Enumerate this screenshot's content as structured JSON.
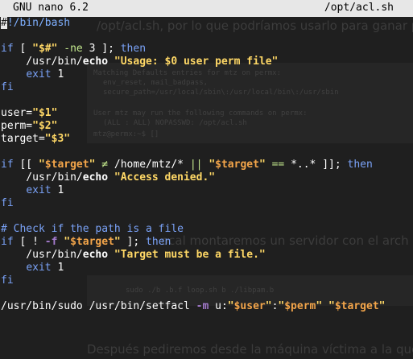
{
  "window": {
    "app_title": "GNU nano 6.2",
    "file_path": "/opt/acl.sh"
  },
  "colors": {
    "titlebar_bg": "#e7e7e7",
    "editor_bg": "#1f1f1f",
    "keyword": "#7aa2f7",
    "string": "#ffd866",
    "variable": "#f3a54a",
    "operator": "#c3e88d",
    "flag": "#a37acc"
  },
  "lines": [
    [
      [
        "cursor",
        "#"
      ],
      [
        "shebang",
        "!/bin/bash"
      ]
    ],
    [],
    [
      [
        "kw",
        "if"
      ],
      [
        "t",
        " [ "
      ],
      [
        "str",
        "\"$#\""
      ],
      [
        "t",
        " "
      ],
      [
        "op",
        "-ne"
      ],
      [
        "t",
        " 3 ]; "
      ],
      [
        "kw",
        "then"
      ]
    ],
    [
      [
        "t",
        "    /usr/bin/"
      ],
      [
        "bi",
        "echo"
      ],
      [
        "t",
        " "
      ],
      [
        "str",
        "\"Usage: $0 user perm file\""
      ]
    ],
    [
      [
        "t",
        "    "
      ],
      [
        "kw",
        "exit"
      ],
      [
        "t",
        " 1"
      ]
    ],
    [
      [
        "kw",
        "fi"
      ]
    ],
    [],
    [
      [
        "t",
        "user="
      ],
      [
        "str",
        "\"$1\""
      ]
    ],
    [
      [
        "t",
        "perm="
      ],
      [
        "str",
        "\"$2\""
      ]
    ],
    [
      [
        "t",
        "target="
      ],
      [
        "str",
        "\"$3\""
      ]
    ],
    [],
    [
      [
        "kw",
        "if"
      ],
      [
        "t",
        " [[ "
      ],
      [
        "str",
        "\""
      ],
      [
        "var",
        "$target"
      ],
      [
        "str",
        "\""
      ],
      [
        "t",
        " "
      ],
      [
        "op",
        "≠"
      ],
      [
        "t",
        " /home/mtz/* "
      ],
      [
        "op",
        "||"
      ],
      [
        "t",
        " "
      ],
      [
        "str",
        "\""
      ],
      [
        "var",
        "$target"
      ],
      [
        "str",
        "\""
      ],
      [
        "t",
        " "
      ],
      [
        "op",
        "=="
      ],
      [
        "t",
        " *..* ]]; "
      ],
      [
        "kw",
        "then"
      ]
    ],
    [
      [
        "t",
        "    /usr/bin/"
      ],
      [
        "bi",
        "echo"
      ],
      [
        "t",
        " "
      ],
      [
        "str",
        "\"Access denied.\""
      ]
    ],
    [
      [
        "t",
        "    "
      ],
      [
        "kw",
        "exit"
      ],
      [
        "t",
        " 1"
      ]
    ],
    [
      [
        "kw",
        "fi"
      ]
    ],
    [],
    [
      [
        "cmt",
        "# Check if the path is a file"
      ]
    ],
    [
      [
        "kw",
        "if"
      ],
      [
        "t",
        " [ ! "
      ],
      [
        "flag",
        "-f"
      ],
      [
        "t",
        " "
      ],
      [
        "str",
        "\""
      ],
      [
        "var",
        "$target"
      ],
      [
        "str",
        "\""
      ],
      [
        "t",
        " ]; "
      ],
      [
        "kw",
        "then"
      ]
    ],
    [
      [
        "t",
        "    /usr/bin/"
      ],
      [
        "bi",
        "echo"
      ],
      [
        "t",
        " "
      ],
      [
        "str",
        "\"Target must be a file.\""
      ]
    ],
    [
      [
        "t",
        "    "
      ],
      [
        "kw",
        "exit"
      ],
      [
        "t",
        " 1"
      ]
    ],
    [
      [
        "kw",
        "fi"
      ]
    ],
    [],
    [
      [
        "t",
        "/usr/bin/sudo /usr/bin/setfacl "
      ],
      [
        "flag",
        "-m"
      ],
      [
        "t",
        " u:"
      ],
      [
        "str",
        "\""
      ],
      [
        "var",
        "$user"
      ],
      [
        "str",
        "\""
      ],
      [
        "t",
        ":"
      ],
      [
        "str",
        "\""
      ],
      [
        "var",
        "$perm"
      ],
      [
        "str",
        "\""
      ],
      [
        "t",
        " "
      ],
      [
        "str",
        "\""
      ],
      [
        "var",
        "$target"
      ],
      [
        "str",
        "\""
      ]
    ]
  ]
}
